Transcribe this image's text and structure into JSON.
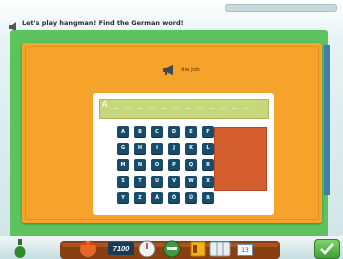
{
  "header": {
    "instruction": "Let's play hangman! Find the German word!"
  },
  "word_prompt": {
    "label": "die Job"
  },
  "answer": {
    "text": "A _ _ _ _ _ _ _ _ _ _ _ _"
  },
  "keyboard": {
    "rows": [
      [
        "A",
        "B",
        "C",
        "D",
        "E",
        "F"
      ],
      [
        "G",
        "H",
        "I",
        "J",
        "K",
        "L"
      ],
      [
        "M",
        "N",
        "O",
        "P",
        "Q",
        "R"
      ],
      [
        "S",
        "T",
        "U",
        "V",
        "W",
        "X"
      ],
      [
        "Y",
        "Z",
        "Ä",
        "Ö",
        "Ü",
        "ß"
      ]
    ]
  },
  "toolbar": {
    "score": "7100",
    "page": "13"
  },
  "colors": {
    "board": "#f5a32a",
    "green": "#5cc35f",
    "key": "#174c6a",
    "answer_bar": "#c6d97a",
    "picture": "#d45e2e"
  }
}
